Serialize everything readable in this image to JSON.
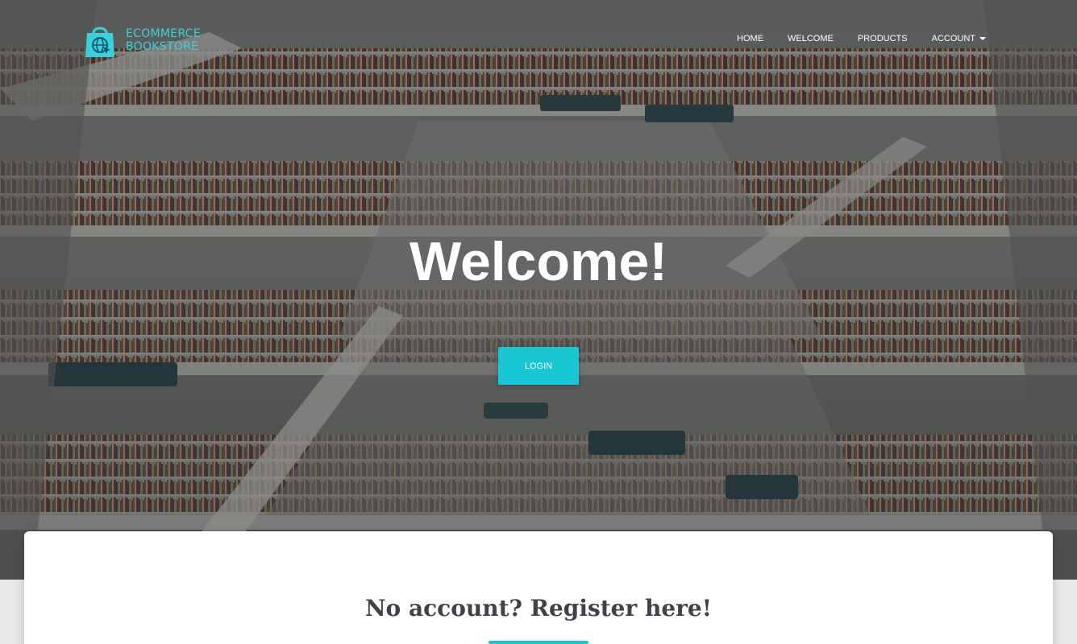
{
  "brand": {
    "line1": "ECOMMERCE",
    "line2": "BOOKSTORE",
    "icon": "shopping-bag-globe-icon",
    "color": "#3ad1de"
  },
  "nav": {
    "items": [
      {
        "label": "HOME"
      },
      {
        "label": "WELCOME"
      },
      {
        "label": "PRODUCTS"
      },
      {
        "label": "ACCOUNT",
        "dropdown": true
      }
    ]
  },
  "hero": {
    "title": "Welcome!",
    "button_label": "LOGIN",
    "accent": "#18c7d4"
  },
  "register": {
    "title": "No account? Register here!"
  }
}
